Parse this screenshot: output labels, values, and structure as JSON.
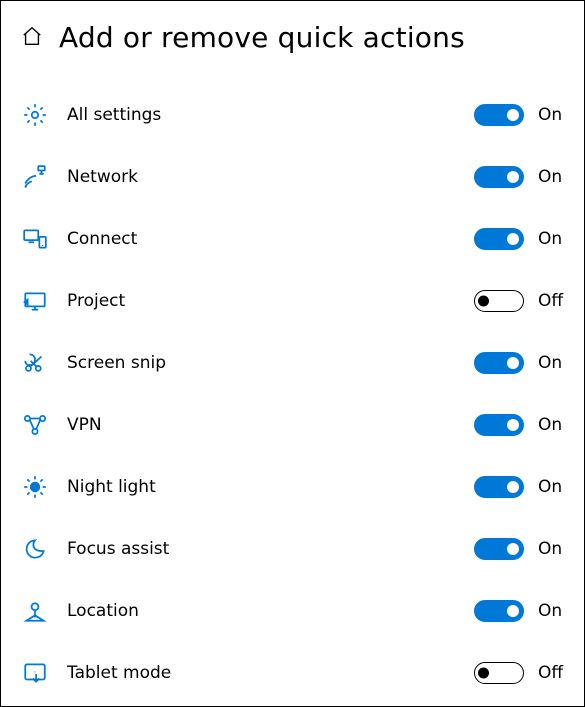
{
  "page": {
    "title": "Add or remove quick actions"
  },
  "labels": {
    "on": "On",
    "off": "Off"
  },
  "colors": {
    "accent": "#0078d7"
  },
  "items": [
    {
      "icon": "settings-icon",
      "label": "All settings",
      "state": "on"
    },
    {
      "icon": "network-icon",
      "label": "Network",
      "state": "on"
    },
    {
      "icon": "connect-icon",
      "label": "Connect",
      "state": "on"
    },
    {
      "icon": "project-icon",
      "label": "Project",
      "state": "off"
    },
    {
      "icon": "screen-snip-icon",
      "label": "Screen snip",
      "state": "on"
    },
    {
      "icon": "vpn-icon",
      "label": "VPN",
      "state": "on"
    },
    {
      "icon": "night-light-icon",
      "label": "Night light",
      "state": "on"
    },
    {
      "icon": "focus-assist-icon",
      "label": "Focus assist",
      "state": "on"
    },
    {
      "icon": "location-icon",
      "label": "Location",
      "state": "on"
    },
    {
      "icon": "tablet-mode-icon",
      "label": "Tablet mode",
      "state": "off"
    }
  ]
}
